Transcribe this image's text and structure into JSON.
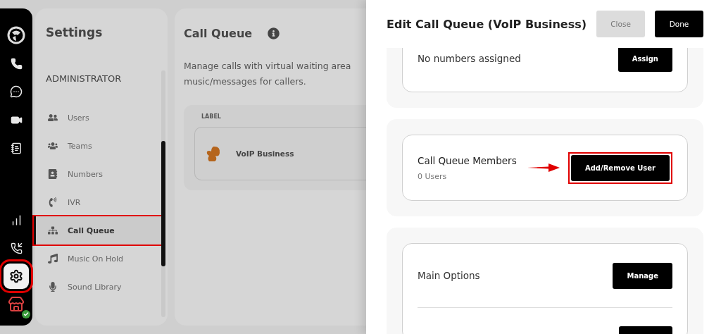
{
  "rail": {
    "items": [
      {
        "selected": false,
        "highlighted": false
      },
      {
        "selected": false,
        "highlighted": false
      },
      {
        "selected": false,
        "highlighted": false
      },
      {
        "selected": false,
        "highlighted": false
      },
      {
        "selected": false,
        "highlighted": false
      },
      {
        "selected": false,
        "highlighted": false
      },
      {
        "selected": false,
        "highlighted": false
      },
      {
        "selected": true,
        "highlighted": true
      },
      {
        "selected": false,
        "highlighted": false
      }
    ]
  },
  "sidebar": {
    "title": "Settings",
    "section": "ADMINISTRATOR",
    "items": [
      {
        "label": "Users",
        "selected": false,
        "highlighted": false
      },
      {
        "label": "Teams",
        "selected": false,
        "highlighted": false
      },
      {
        "label": "Numbers",
        "selected": false,
        "highlighted": false
      },
      {
        "label": "IVR",
        "selected": false,
        "highlighted": false
      },
      {
        "label": "Call Queue",
        "selected": true,
        "highlighted": true
      },
      {
        "label": "Music On Hold",
        "selected": false,
        "highlighted": false
      },
      {
        "label": "Sound Library",
        "selected": false,
        "highlighted": false
      }
    ]
  },
  "main": {
    "title": "Call Queue",
    "description": [
      "Manage calls with virtual waiting area",
      "music/messages for callers."
    ],
    "table": {
      "columns": [
        "LABEL"
      ],
      "rows": [
        {
          "label": "VoIP Business"
        }
      ]
    }
  },
  "drawer": {
    "title": "Edit Call Queue (VoIP Business)",
    "buttons": [
      {
        "label": "Close",
        "kind": "secondary"
      },
      {
        "label": "Done",
        "kind": "primary"
      }
    ],
    "sections": [
      {
        "kind": "numbers",
        "text": "No numbers assigned",
        "button": {
          "label": "Assign"
        }
      },
      {
        "kind": "members",
        "title": "Call Queue Members",
        "subtitle": "0 Users",
        "arrow": true,
        "button": {
          "label": "Add/Remove User",
          "highlighted": true
        }
      },
      {
        "kind": "options",
        "title": "Main Options",
        "button": {
          "label": "Manage"
        }
      }
    ]
  }
}
